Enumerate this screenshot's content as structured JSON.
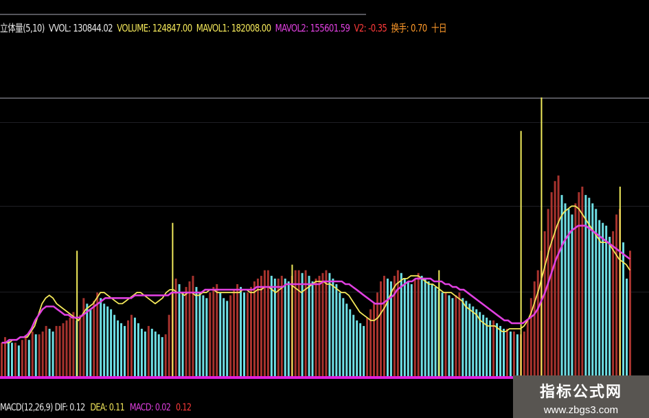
{
  "header": {
    "items": [
      {
        "text": "立体量(5,10)",
        "color": "#e8e8e8"
      },
      {
        "text": "VVOL: 130844.02",
        "color": "#e8e8e8"
      },
      {
        "text": "VOLUME: 124847.00",
        "color": "#f4e85a"
      },
      {
        "text": "MAVOL1: 182008.00",
        "color": "#f4e85a"
      },
      {
        "text": "MAVOL2: 155601.59",
        "color": "#e040e0"
      },
      {
        "text": "V2: -0.35",
        "color": "#ff3b3b"
      },
      {
        "text": "换手: 0.70",
        "color": "#ff9a2a"
      },
      {
        "text": "十日",
        "color": "#ff9a2a"
      }
    ]
  },
  "footer": {
    "items": [
      {
        "text": "MACD(12,26,9) DIF: 0.12",
        "color": "#e8e8e8"
      },
      {
        "text": "DEA: 0.11",
        "color": "#f4e85a"
      },
      {
        "text": "MACD: 0.02",
        "color": "#e040e0"
      },
      {
        "text": "0.12",
        "color": "#ff3b3b"
      }
    ]
  },
  "watermark": {
    "title": "指标公式网",
    "url": "www.zbgs3.com"
  },
  "colors": {
    "up_bar": "#a8332e",
    "down_bar": "#6fe0e6",
    "peak_bar": "#f2ec5c",
    "ma_fast": "#f4e85a",
    "ma_slow": "#e040e0",
    "baseline": "#e020e0"
  },
  "chart_data": {
    "type": "bar",
    "title": "",
    "xlabel": "",
    "ylabel": "",
    "ylim": [
      0,
      100
    ],
    "grid": true,
    "series": [
      {
        "values": [
          12,
          14,
          13,
          12,
          12,
          11,
          13,
          14,
          13,
          16,
          15,
          15,
          16,
          18,
          17,
          16,
          18,
          18,
          19,
          20,
          21,
          23,
          20,
          22,
          28,
          26,
          24,
          27,
          30,
          28,
          26,
          25,
          24,
          22,
          20,
          19,
          18,
          20,
          22,
          21,
          19,
          17,
          16,
          18,
          17,
          16,
          15,
          14,
          15,
          22,
          30,
          35,
          33,
          30,
          32,
          34,
          36,
          32,
          30,
          29,
          28,
          30,
          32,
          33,
          30,
          28,
          27,
          29,
          31,
          33,
          32,
          30,
          30,
          32,
          34,
          35,
          36,
          38,
          38,
          36,
          35,
          35,
          36,
          35,
          34,
          36,
          38,
          38,
          37,
          38,
          36,
          34,
          35,
          36,
          37,
          38,
          37,
          35,
          33,
          30,
          28,
          26,
          24,
          22,
          20,
          19,
          18,
          21,
          24,
          26,
          30,
          34,
          36,
          35,
          34,
          36,
          38,
          37,
          35,
          34,
          33,
          35,
          37,
          36,
          35,
          34,
          33,
          32,
          31,
          30,
          30,
          29,
          28,
          29,
          30,
          28,
          27,
          26,
          25,
          24,
          23,
          22,
          21,
          20,
          20,
          19,
          18,
          17,
          17,
          16,
          16,
          15,
          15,
          16,
          20,
          28,
          34,
          38,
          45,
          52,
          60,
          66,
          70,
          72,
          65,
          62,
          60,
          58,
          62,
          66,
          68,
          65,
          64,
          62,
          60,
          56,
          55,
          54,
          50,
          52,
          58,
          60,
          48,
          35,
          45
        ],
        "colors_key": "bar_mix"
      },
      {
        "name": "",
        "values": [
          12,
          12,
          12,
          13,
          13,
          14,
          14,
          14,
          16,
          18,
          22,
          26,
          28,
          29,
          28,
          26,
          25,
          24,
          23,
          22,
          21,
          20,
          22,
          24,
          25,
          26,
          28,
          30,
          30,
          29,
          28,
          27,
          26,
          26,
          27,
          28,
          29,
          30,
          30,
          29,
          28,
          27,
          26,
          27,
          28,
          30,
          31,
          31,
          30,
          30,
          29,
          30,
          30,
          29,
          29,
          30,
          30,
          31,
          31,
          30,
          30,
          30,
          30,
          30,
          30,
          30,
          31,
          31,
          30,
          30,
          31,
          31,
          32,
          32,
          31,
          30,
          31,
          32,
          33,
          33,
          32,
          31,
          30,
          31,
          32,
          33,
          34,
          34,
          34,
          33,
          33,
          32,
          31,
          30,
          30,
          29,
          27,
          25,
          23,
          22,
          21,
          20,
          20,
          21,
          23,
          25,
          28,
          31,
          33,
          34,
          35,
          35,
          36,
          36,
          36,
          35,
          34,
          33,
          33,
          32,
          31,
          30,
          30,
          30,
          29,
          28,
          27,
          25,
          24,
          23,
          22,
          20,
          19,
          18,
          18,
          18,
          17,
          16,
          16,
          17,
          17,
          17,
          17,
          18,
          20,
          23,
          27,
          31,
          36,
          41,
          46,
          50,
          54,
          57,
          59,
          60,
          61,
          61,
          60,
          58,
          56,
          54,
          52,
          50,
          48,
          48,
          48,
          46,
          44,
          42,
          41,
          40,
          38
        ],
        "line": "ma_fast"
      },
      {
        "name": "",
        "values": [
          12,
          12,
          13,
          13,
          13,
          14,
          14,
          15,
          17,
          20,
          22,
          24,
          25,
          25,
          25,
          24,
          23,
          22,
          22,
          21,
          21,
          21,
          22,
          23,
          24,
          25,
          26,
          27,
          28,
          28,
          28,
          28,
          28,
          28,
          28,
          28,
          29,
          29,
          29,
          29,
          29,
          29,
          29,
          29,
          29,
          29,
          30,
          30,
          30,
          30,
          30,
          30,
          30,
          30,
          30,
          31,
          31,
          31,
          31,
          31,
          31,
          31,
          31,
          31,
          31,
          31,
          31,
          31,
          31,
          32,
          32,
          32,
          32,
          32,
          32,
          32,
          32,
          33,
          33,
          33,
          33,
          33,
          33,
          33,
          33,
          33,
          33,
          34,
          34,
          34,
          34,
          34,
          34,
          33,
          33,
          32,
          31,
          30,
          29,
          28,
          27,
          26,
          26,
          26,
          27,
          28,
          29,
          31,
          32,
          33,
          34,
          34,
          35,
          35,
          35,
          35,
          35,
          34,
          34,
          34,
          33,
          33,
          32,
          32,
          31,
          31,
          30,
          29,
          28,
          27,
          26,
          25,
          24,
          23,
          22,
          21,
          20,
          20,
          19,
          19,
          19,
          19,
          20,
          21,
          22,
          24,
          27,
          30,
          34,
          38,
          42,
          45,
          48,
          50,
          52,
          53,
          54,
          54,
          54,
          53,
          52,
          51,
          50,
          49,
          48,
          47,
          46,
          45,
          44,
          43,
          42
        ],
        "line": "ma_slow"
      }
    ],
    "peaks": [
      {
        "index": 22,
        "value": 45
      },
      {
        "index": 50,
        "value": 55
      },
      {
        "index": 85,
        "value": 40
      },
      {
        "index": 128,
        "value": 38
      },
      {
        "index": 152,
        "value": 88
      },
      {
        "index": 158,
        "value": 100
      },
      {
        "index": 181,
        "value": 68
      }
    ]
  }
}
